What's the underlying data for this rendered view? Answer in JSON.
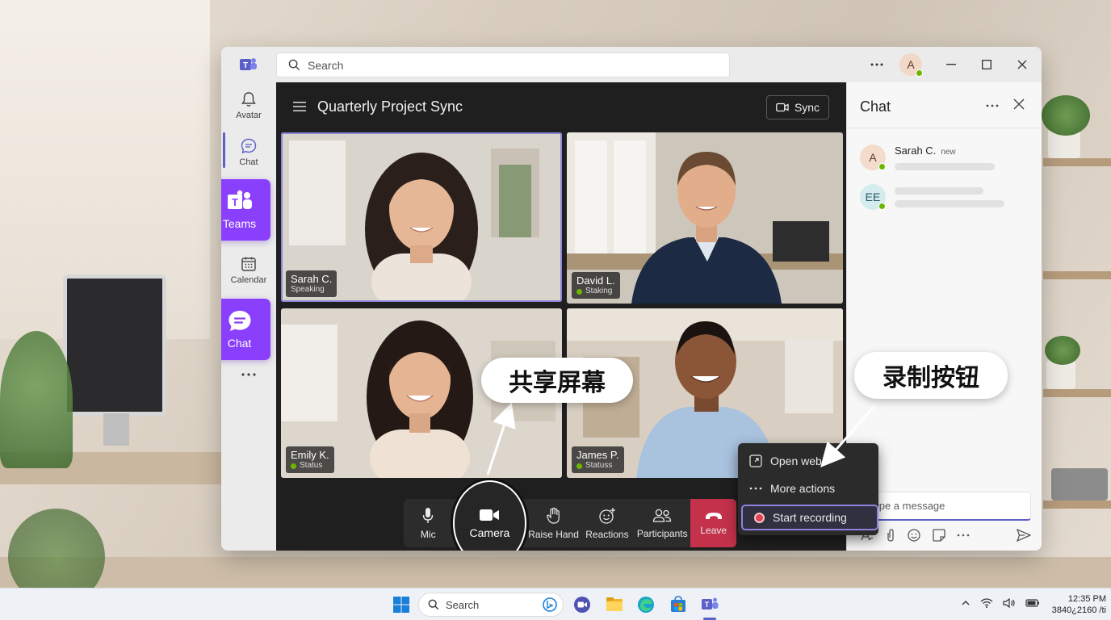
{
  "window": {
    "search_placeholder": "Search",
    "avatar_initial": "A"
  },
  "rail": {
    "items": [
      {
        "label": "Avatar",
        "icon": "bell-icon"
      },
      {
        "label": "Chat",
        "icon": "chat-icon"
      },
      {
        "label": "Teams",
        "icon": "teams-icon"
      },
      {
        "label": "Calendar",
        "icon": "calendar-icon"
      },
      {
        "label": "Chat",
        "icon": "chat-bubble-icon"
      }
    ],
    "more": "..."
  },
  "meeting": {
    "title": "Quarterly Project Sync",
    "sync_label": "Sync",
    "participants": [
      {
        "name": "Sarah C.",
        "status": "Speaking"
      },
      {
        "name": "David L.",
        "status": "Staking"
      },
      {
        "name": "Emily K.",
        "status": "Status"
      },
      {
        "name": "James P.",
        "status": "Statuss"
      }
    ]
  },
  "controls": {
    "mic": "Mic",
    "camera": "Camera",
    "raise_hand": "Raise Hand",
    "reactions": "Reactions",
    "participants": "Participants",
    "leave": "Leave"
  },
  "context_menu": {
    "open_web": "Open web",
    "more_actions": "More actions",
    "start_recording": "Start recording"
  },
  "chat": {
    "title": "Chat",
    "conversations": [
      {
        "initials": "A",
        "name": "Sarah C.",
        "badge": "new"
      },
      {
        "initials": "EE",
        "name": "",
        "badge": ""
      }
    ],
    "input_placeholder": "Type a message"
  },
  "callouts": {
    "share_screen": "共享屏幕",
    "record_button": "录制按钮"
  },
  "taskbar": {
    "search_label": "Search",
    "time": "12:35 PM",
    "resolution": "3840¿2160 /ti"
  },
  "colors": {
    "accent": "#8a3ffc",
    "teams_purple": "#5b5fc7",
    "leave_red": "#c4314b",
    "stage_bg": "#1f1f1f"
  }
}
